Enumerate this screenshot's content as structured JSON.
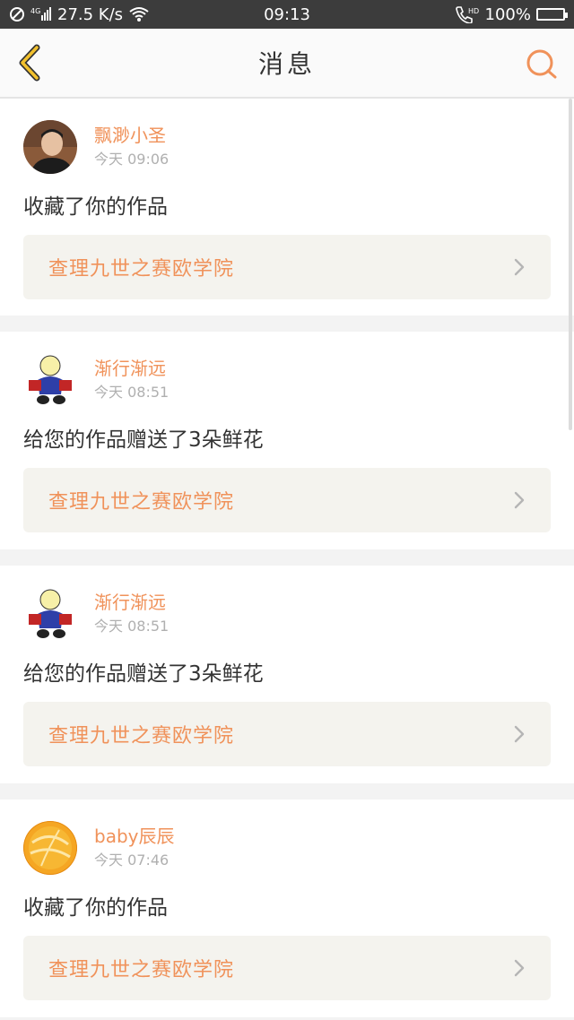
{
  "status_bar": {
    "network": "27.5 K/s",
    "signal_label": "4G",
    "time": "09:13",
    "hd_label": "HD",
    "battery": "100%"
  },
  "header": {
    "title": "消息"
  },
  "messages": [
    {
      "user": "飘渺小圣",
      "time": "今天 09:06",
      "text": "收藏了你的作品",
      "work": "查理九世之赛欧学院",
      "avatar": "photo-avatar"
    },
    {
      "user": "渐行渐远",
      "time": "今天 08:51",
      "text": "给您的作品赠送了3朵鲜花",
      "work": "查理九世之赛欧学院",
      "avatar": "cartoon-avatar"
    },
    {
      "user": "渐行渐远",
      "time": "今天 08:51",
      "text": "给您的作品赠送了3朵鲜花",
      "work": "查理九世之赛欧学院",
      "avatar": "cartoon-avatar"
    },
    {
      "user": "baby辰辰",
      "time": "今天 07:46",
      "text": "收藏了你的作品",
      "work": "查理九世之赛欧学院",
      "avatar": "orange-avatar"
    }
  ],
  "colors": {
    "accent": "#f0925a",
    "back_icon": "#f2c12e",
    "search_icon": "#f0925a"
  }
}
